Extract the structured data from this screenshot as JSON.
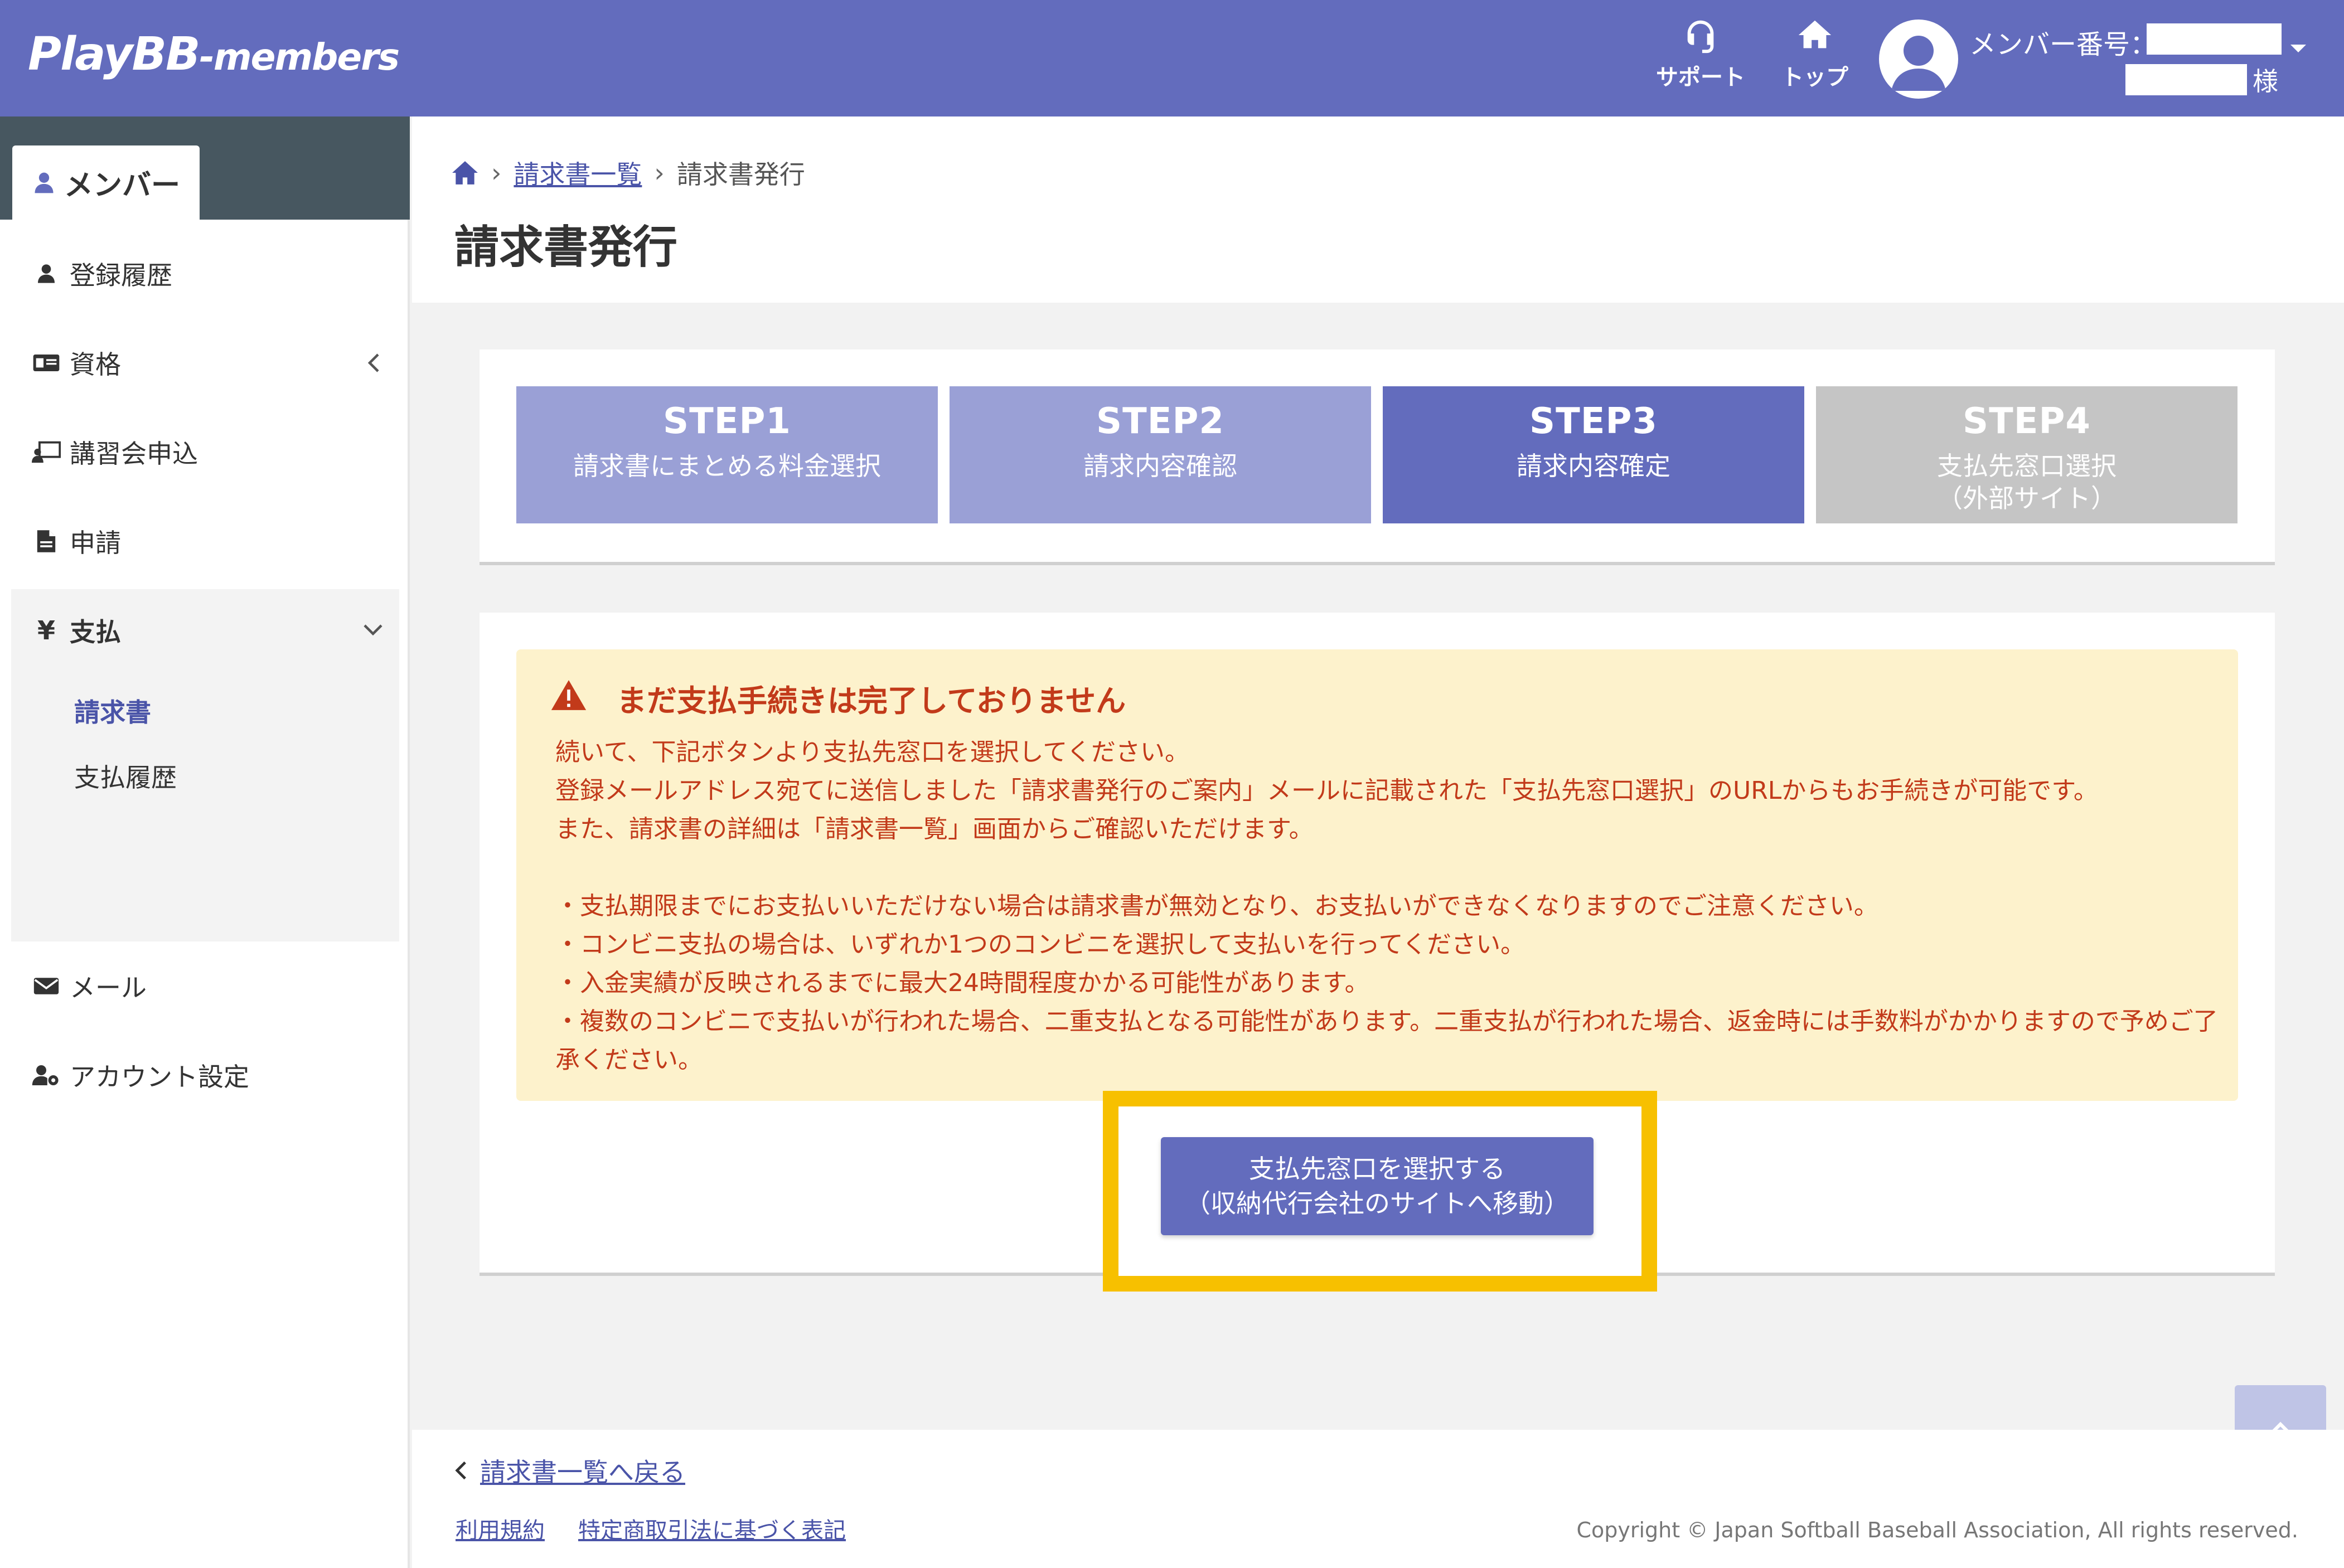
{
  "header": {
    "logo_main": "PlayBB",
    "logo_sub": "-members",
    "support_label": "サポート",
    "top_label": "トップ",
    "member_number_label": "メンバー番号：",
    "honorific": "様"
  },
  "sidebar": {
    "active_tab": "メンバー",
    "items": {
      "history": "登録履歴",
      "qualification": "資格",
      "course": "講習会申込",
      "application": "申請",
      "payment": "支払",
      "invoice": "請求書",
      "payment_history": "支払履歴",
      "mail": "メール",
      "account": "アカウント設定"
    }
  },
  "breadcrumb": {
    "list": "請求書一覧",
    "current": "請求書発行"
  },
  "page_title": "請求書発行",
  "steps": [
    {
      "num": "STEP1",
      "desc": "請求書にまとめる料金選択",
      "color": "#9aa0d6"
    },
    {
      "num": "STEP2",
      "desc": "請求内容確認",
      "color": "#9aa0d6"
    },
    {
      "num": "STEP3",
      "desc": "請求内容確定",
      "color": "#636cbd"
    },
    {
      "num": "STEP4",
      "desc": "支払先窓口選択\n（外部サイト）",
      "color": "#c5c5c5"
    }
  ],
  "alert": {
    "title": "まだ支払手続きは完了しておりません",
    "line1": "続いて、下記ボタンより支払先窓口を選択してください。",
    "line2": "登録メールアドレス宛てに送信しました「請求書発行のご案内」メールに記載された「支払先窓口選択」のURLからもお手続きが可能です。",
    "line3": "また、請求書の詳細は「請求書一覧」画面からご確認いただけます。",
    "bullet1": "・支払期限までにお支払いいただけない場合は請求書が無効となり、お支払いができなくなりますのでご注意ください。",
    "bullet2": "・コンビニ支払の場合は、いずれか1つのコンビニを選択して支払いを行ってください。",
    "bullet3": "・入金実績が反映されるまでに最大24時間程度かかる可能性があります。",
    "bullet4": "・複数のコンビニで支払いが行われた場合、二重支払となる可能性があります。二重支払が行われた場合、返金時には手数料がかかりますので予めご了承ください。"
  },
  "action_button": {
    "line1": "支払先窓口を選択する",
    "line2": "（収納代行会社のサイトへ移動）"
  },
  "footer": {
    "back": "請求書一覧へ戻る",
    "terms": "利用規約",
    "tokusho": "特定商取引法に基づく表記",
    "copyright": "Copyright © Japan Softball Baseball Association, All rights reserved."
  },
  "colors": {
    "brand": "#636cbd",
    "alert_bg": "#fdf2cc",
    "alert_text": "#c23a1a",
    "highlight": "#f7c000"
  }
}
